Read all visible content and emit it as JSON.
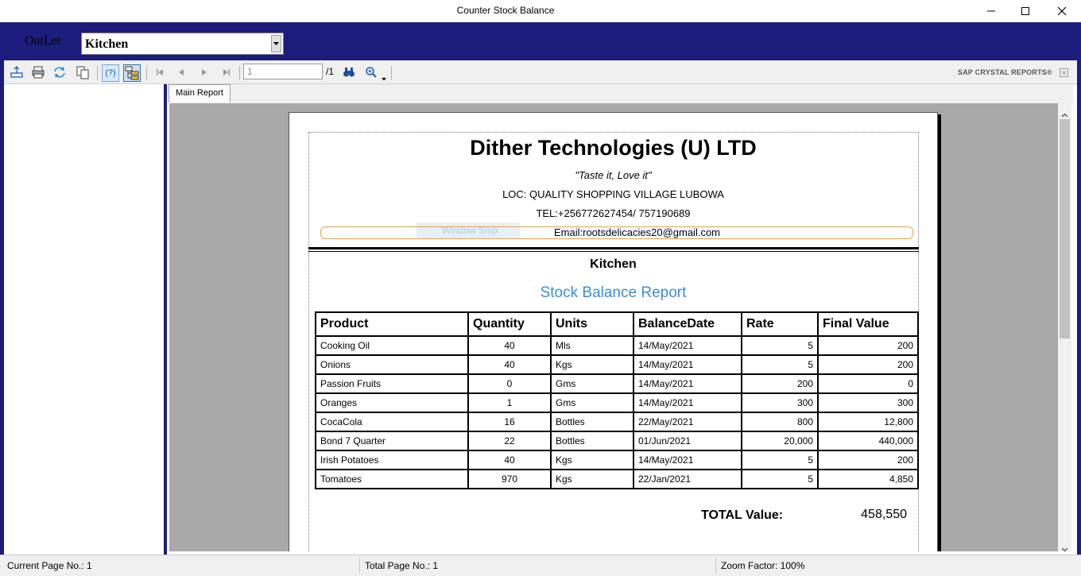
{
  "window": {
    "title": "Counter Stock Balance"
  },
  "outlet": {
    "label": "OutLet",
    "value": "Kitchen"
  },
  "toolbar": {
    "page_number": "1",
    "page_total": "/1",
    "brand": "SAP CRYSTAL REPORTS®"
  },
  "tabs": [
    {
      "label": "Main Report"
    }
  ],
  "report": {
    "company": "Dither Technologies (U) LTD",
    "tagline": "\"Taste it, Love it\"",
    "location": "LOC:  QUALITY SHOPPING VILLAGE LUBOWA",
    "tel": "TEL:+256772627454/ 757190689",
    "email": "Email:rootsdelicacies20@gmail.com",
    "overlay_text": "Window Snip",
    "outlet_name": "Kitchen",
    "title": "Stock Balance Report",
    "columns": [
      "Product",
      "Quantity",
      "Units",
      "BalanceDate",
      "Rate",
      "Final Value"
    ],
    "rows": [
      [
        "Cooking Oil",
        "40",
        "Mls",
        "14/May/2021",
        "5",
        "200"
      ],
      [
        "Onions",
        "40",
        "Kgs",
        "14/May/2021",
        "5",
        "200"
      ],
      [
        "Passion Fruits",
        "0",
        "Gms",
        "14/May/2021",
        "200",
        "0"
      ],
      [
        "Oranges",
        "1",
        "Gms",
        "14/May/2021",
        "300",
        "300"
      ],
      [
        "CocaCola",
        "16",
        "Bottles",
        "22/May/2021",
        "800",
        "12,800"
      ],
      [
        "Bond 7 Quarter",
        "22",
        "Bottles",
        "01/Jun/2021",
        "20,000",
        "440,000"
      ],
      [
        "Irish Potatoes",
        "40",
        "Kgs",
        "14/May/2021",
        "5",
        "200"
      ],
      [
        "Tomatoes",
        "970",
        "Kgs",
        "22/Jan/2021",
        "5",
        "4,850"
      ]
    ],
    "total_label": "TOTAL Value:",
    "total_value": "458,550"
  },
  "status": {
    "current_page": "Current Page No.: 1",
    "total_page": "Total Page No.: 1",
    "zoom": "Zoom Factor: 100%"
  },
  "colors": {
    "frame": "#1c1c7c",
    "report_title": "#3a8fd0",
    "viewer_bg": "#a9a9a9"
  }
}
